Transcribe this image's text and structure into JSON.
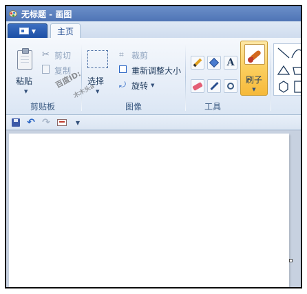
{
  "window": {
    "title": "无标题 - 画图"
  },
  "tabs": {
    "home": "主页"
  },
  "clipboard": {
    "group_label": "剪贴板",
    "paste": "粘贴",
    "cut": "剪切",
    "copy": "复制"
  },
  "image": {
    "group_label": "图像",
    "select": "选择",
    "crop": "裁剪",
    "resize": "重新调整大小",
    "rotate": "旋转"
  },
  "tools": {
    "group_label": "工具",
    "text_tool": "A"
  },
  "brushes": {
    "label": "刷子"
  },
  "watermark": {
    "line1": "百度ID:",
    "line2": "木木头a"
  },
  "icons": {
    "app": "paint-palette-icon",
    "paste": "clipboard-icon",
    "cut": "scissors-icon",
    "copy": "copy-icon",
    "crop": "crop-icon",
    "resize": "resize-icon",
    "rotate": "rotate-icon",
    "pencil": "pencil-icon",
    "fill": "paint-bucket-icon",
    "eraser": "eraser-icon",
    "picker": "color-picker-icon",
    "magnifier": "magnifier-icon",
    "save": "save-icon",
    "undo": "undo-icon",
    "redo": "redo-icon",
    "email": "email-icon"
  },
  "colors": {
    "accent": "#fbcf5e",
    "titlebar": "#4f74b5",
    "menu_button": "#1b4fa6"
  }
}
